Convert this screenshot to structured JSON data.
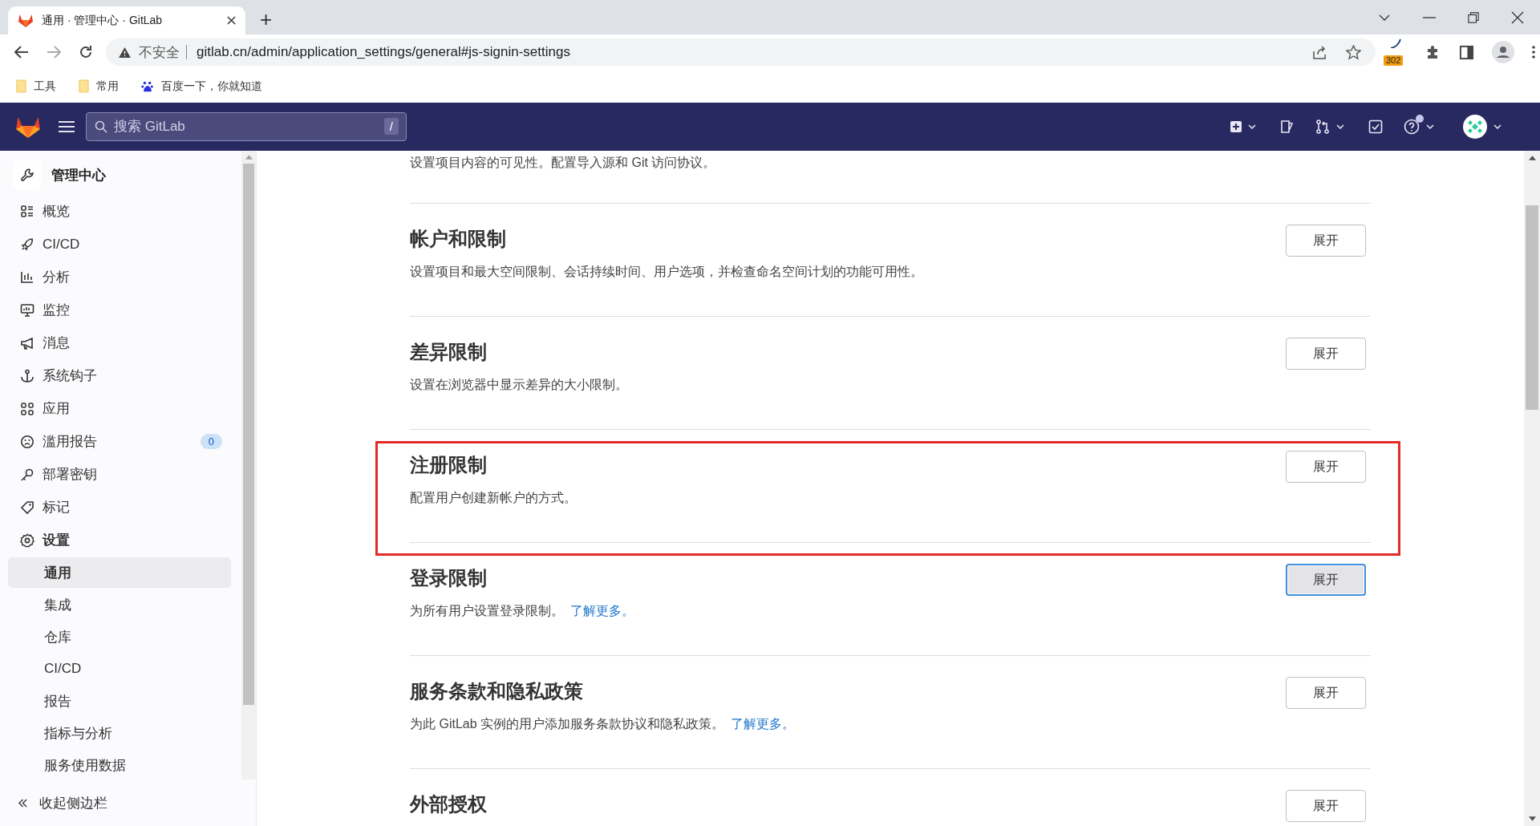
{
  "browser": {
    "tab": {
      "title": "通用 · 管理中心 · GitLab",
      "selected": true
    },
    "new_tab": "+",
    "address": {
      "security": "不安全",
      "url": "gitlab.cn/admin/application_settings/general#js-signin-settings"
    },
    "extension_badge": "302",
    "bookmarks": [
      {
        "label": "工具",
        "kind": "folder"
      },
      {
        "label": "常用",
        "kind": "folder"
      },
      {
        "label": "百度一下，你就知道",
        "kind": "site"
      }
    ]
  },
  "header": {
    "search": {
      "placeholder": "搜索 GitLab",
      "shortcut": "/"
    },
    "help_notification": true
  },
  "sidebar": {
    "title": "管理中心",
    "items": [
      {
        "label": "概览",
        "selected": false
      },
      {
        "label": "CI/CD",
        "selected": false
      },
      {
        "label": "分析",
        "selected": false
      },
      {
        "label": "监控",
        "selected": false
      },
      {
        "label": "消息",
        "selected": false
      },
      {
        "label": "系统钩子",
        "selected": false
      },
      {
        "label": "应用",
        "selected": false
      },
      {
        "label": "滥用报告",
        "selected": false,
        "badge": "0"
      },
      {
        "label": "部署密钥",
        "selected": false
      },
      {
        "label": "标记",
        "selected": false
      },
      {
        "label": "设置",
        "selected": true,
        "children": [
          {
            "label": "通用",
            "selected": true
          },
          {
            "label": "集成",
            "selected": false
          },
          {
            "label": "仓库",
            "selected": false
          },
          {
            "label": "CI/CD",
            "selected": false
          },
          {
            "label": "报告",
            "selected": false
          },
          {
            "label": "指标与分析",
            "selected": false
          },
          {
            "label": "服务使用数据",
            "selected": false
          }
        ]
      }
    ],
    "collapse": "收起侧边栏"
  },
  "sections": [
    {
      "description": "设置项目内容的可见性。配置导入源和 Git 访问协议。"
    },
    {
      "title": "帐户和限制",
      "description": "设置项目和最大空间限制、会话持续时间、用户选项，并检查命名空间计划的功能可用性。",
      "button": "展开",
      "focused": false,
      "highlighted": false
    },
    {
      "title": "差异限制",
      "description": "设置在浏览器中显示差异的大小限制。",
      "button": "展开",
      "focused": false,
      "highlighted": false
    },
    {
      "title": "注册限制",
      "description": "配置用户创建新帐户的方式。",
      "button": "展开",
      "focused": false,
      "highlighted": true
    },
    {
      "title": "登录限制",
      "description": "为所有用户设置登录限制。",
      "link": "了解更多。",
      "button": "展开",
      "focused": true,
      "highlighted": false
    },
    {
      "title": "服务条款和隐私政策",
      "description": "为此 GitLab 实例的用户添加服务条款协议和隐私政策。",
      "link": "了解更多。",
      "button": "展开",
      "focused": false,
      "highlighted": false
    },
    {
      "title": "外部授权",
      "button": "展开",
      "focused": false,
      "highlighted": false
    }
  ]
}
